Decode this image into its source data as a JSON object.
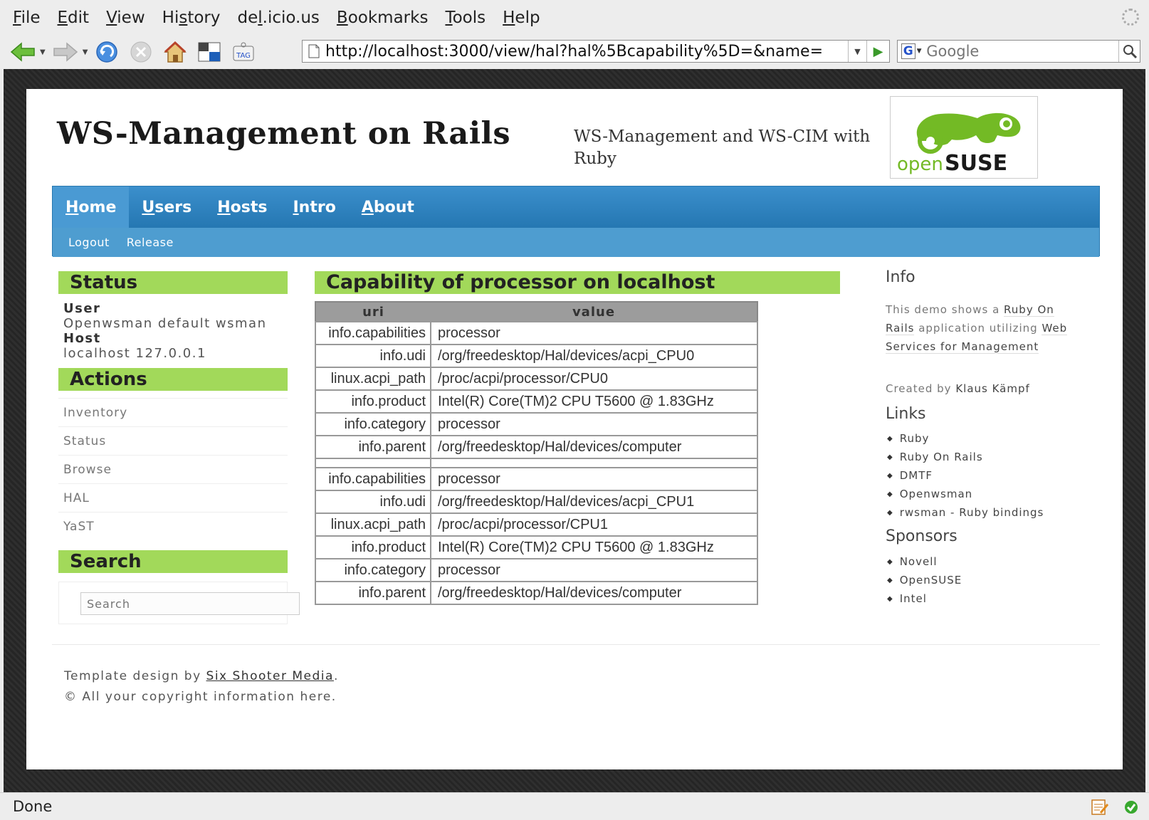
{
  "browser": {
    "menu": [
      {
        "pre": "",
        "key": "F",
        "post": "ile"
      },
      {
        "pre": "",
        "key": "E",
        "post": "dit"
      },
      {
        "pre": "",
        "key": "V",
        "post": "iew"
      },
      {
        "pre": "Hi",
        "key": "s",
        "post": "tory"
      },
      {
        "pre": "de",
        "key": "l",
        "post": ".icio.us"
      },
      {
        "pre": "",
        "key": "B",
        "post": "ookmarks"
      },
      {
        "pre": "",
        "key": "T",
        "post": "ools"
      },
      {
        "pre": "",
        "key": "H",
        "post": "elp"
      }
    ],
    "url": "http://localhost:3000/view/hal?hal%5Bcapability%5D=&name=",
    "search_placeholder": "Google",
    "status": "Done"
  },
  "site": {
    "title": "WS-Management on Rails",
    "tagline": "WS-Management and WS-CIM with Ruby",
    "logo_text_open": "open",
    "logo_text_suse": "SUSE"
  },
  "nav": {
    "primary": [
      {
        "key": "H",
        "rest": "ome",
        "active": true
      },
      {
        "key": "U",
        "rest": "sers",
        "active": false
      },
      {
        "key": "H",
        "rest": "osts",
        "active": false
      },
      {
        "key": "I",
        "rest": "ntro",
        "active": false
      },
      {
        "key": "A",
        "rest": "bout",
        "active": false
      }
    ],
    "secondary": [
      "Logout",
      "Release"
    ]
  },
  "sidebar": {
    "status_heading": "Status",
    "user_label": "User",
    "user_value": "Openwsman default wsman",
    "host_label": "Host",
    "host_value": "localhost 127.0.0.1",
    "actions_heading": "Actions",
    "actions": [
      "Inventory",
      "Status",
      "Browse",
      "HAL",
      "YaST"
    ],
    "search_heading": "Search",
    "search_placeholder": "Search"
  },
  "main": {
    "heading": "Capability of processor on localhost",
    "columns": [
      "uri",
      "value"
    ],
    "rows": [
      [
        "info.capabilities",
        "processor"
      ],
      [
        "info.udi",
        "/org/freedesktop/Hal/devices/acpi_CPU0"
      ],
      [
        "linux.acpi_path",
        "/proc/acpi/processor/CPU0"
      ],
      [
        "info.product",
        "Intel(R) Core(TM)2 CPU T5600 @ 1.83GHz"
      ],
      [
        "info.category",
        "processor"
      ],
      [
        "info.parent",
        "/org/freedesktop/Hal/devices/computer"
      ],
      [
        "",
        ""
      ],
      [
        "info.capabilities",
        "processor"
      ],
      [
        "info.udi",
        "/org/freedesktop/Hal/devices/acpi_CPU1"
      ],
      [
        "linux.acpi_path",
        "/proc/acpi/processor/CPU1"
      ],
      [
        "info.product",
        "Intel(R) Core(TM)2 CPU T5600 @ 1.83GHz"
      ],
      [
        "info.category",
        "processor"
      ],
      [
        "info.parent",
        "/org/freedesktop/Hal/devices/computer"
      ]
    ]
  },
  "right": {
    "info_heading": "Info",
    "info_pre": "This demo shows a ",
    "info_link1": "Ruby On Rails",
    "info_mid": " application utilizing ",
    "info_link2": "Web Services for Management",
    "created_pre": "Created by ",
    "created_name": "Klaus Kämpf",
    "links_heading": "Links",
    "links": [
      "Ruby",
      "Ruby On Rails",
      "DMTF",
      "Openwsman",
      "rwsman - Ruby bindings"
    ],
    "sponsors_heading": "Sponsors",
    "sponsors": [
      "Novell",
      "OpenSUSE",
      "Intel"
    ]
  },
  "footer": {
    "design_pre": "Template design by ",
    "design_link": "Six Shooter Media",
    "design_post": ".",
    "copyright": "© All your copyright information here."
  },
  "colors": {
    "accent_green": "#a2d95a",
    "nav_blue": "#2d7fba",
    "suse_green": "#73ba25"
  },
  "icons": [
    "back-arrow-icon",
    "forward-arrow-icon",
    "reload-icon",
    "stop-icon",
    "home-icon",
    "tab-icon",
    "tag-icon",
    "page-icon",
    "go-icon",
    "google-icon",
    "magnifier-icon",
    "notes-icon",
    "check-icon",
    "throbber-icon"
  ]
}
